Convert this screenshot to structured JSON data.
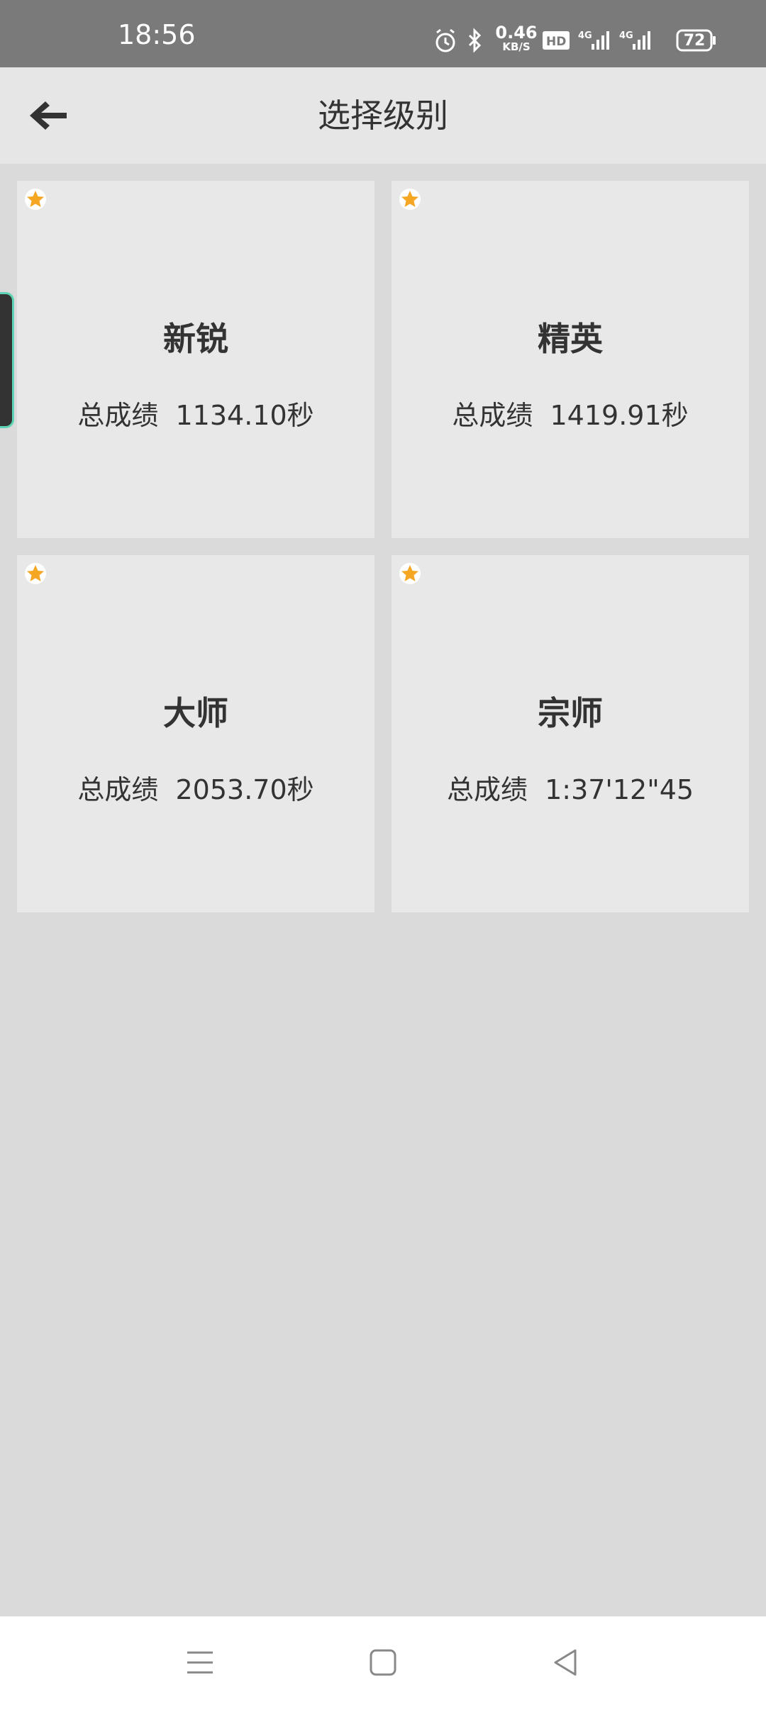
{
  "status_bar": {
    "time": "18:56",
    "net_speed_value": "0.46",
    "net_speed_unit": "KB/S",
    "battery": "72",
    "icons": [
      "alarm-icon",
      "bluetooth-icon",
      "hd-icon",
      "signal-4g-icon",
      "signal-4g-icon",
      "battery-icon"
    ]
  },
  "header": {
    "title": "选择级别",
    "back_icon": "arrow-left-icon"
  },
  "levels": [
    {
      "name": "新锐",
      "score": "总成绩  1134.10秒",
      "icon": "star-icon"
    },
    {
      "name": "精英",
      "score": "总成绩  1419.91秒",
      "icon": "star-icon"
    },
    {
      "name": "大师",
      "score": "总成绩  2053.70秒",
      "icon": "star-icon"
    },
    {
      "name": "宗师",
      "score": "总成绩  1:37'12\"45",
      "icon": "star-icon"
    }
  ],
  "nav_bar": {
    "icons": [
      "menu-icon",
      "home-square-icon",
      "back-triangle-icon"
    ]
  },
  "colors": {
    "status_bar_bg": "#7a7a7a",
    "app_bar_bg": "#e6e6e6",
    "page_bg": "#dadada",
    "card_bg": "#e8e8e8",
    "star": "#f5a623",
    "text": "#333333"
  }
}
